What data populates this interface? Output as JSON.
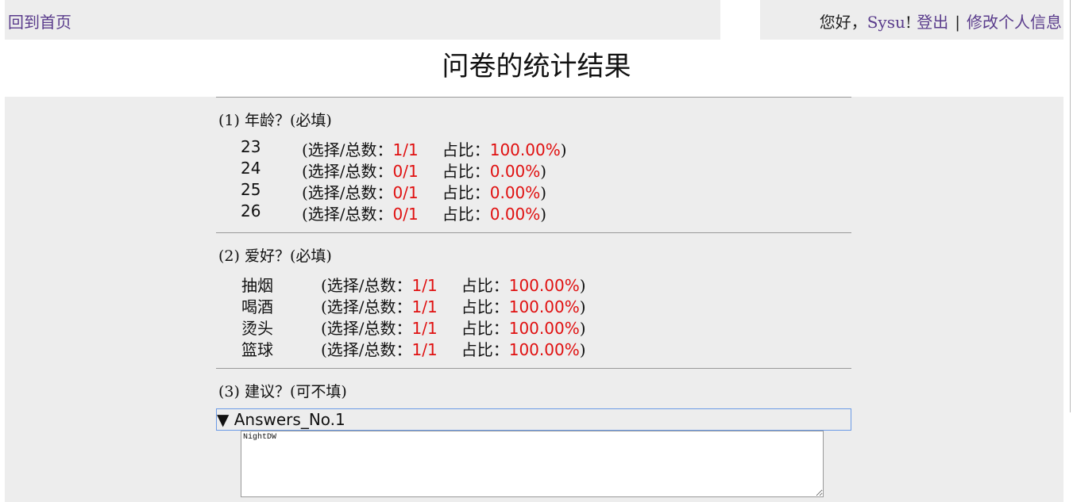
{
  "header": {
    "home_link": "回到首页",
    "greeting_prefix": "您好，",
    "username": "Sysu",
    "greeting_suffix": "!",
    "logout_link": "登出",
    "separator": "|",
    "edit_profile_link": "修改个人信息"
  },
  "page_title": "问卷的统计结果",
  "questions": [
    {
      "title": "(1) 年龄？(必填)",
      "options": [
        {
          "label": "23",
          "stats_prefix": "(选择/总数：",
          "count": "1/1",
          "ratio_prefix": "占比：",
          "ratio": "100.00%",
          "stats_suffix": ")"
        },
        {
          "label": "24",
          "stats_prefix": "(选择/总数：",
          "count": "0/1",
          "ratio_prefix": "占比：",
          "ratio": "0.00%",
          "stats_suffix": ")"
        },
        {
          "label": "25",
          "stats_prefix": "(选择/总数：",
          "count": "0/1",
          "ratio_prefix": "占比：",
          "ratio": "0.00%",
          "stats_suffix": ")"
        },
        {
          "label": "26",
          "stats_prefix": "(选择/总数：",
          "count": "0/1",
          "ratio_prefix": "占比：",
          "ratio": "0.00%",
          "stats_suffix": ")"
        }
      ]
    },
    {
      "title": "(2) 爱好？(必填)",
      "options": [
        {
          "label": "抽烟",
          "stats_prefix": "(选择/总数：",
          "count": "1/1",
          "ratio_prefix": "占比：",
          "ratio": "100.00%",
          "stats_suffix": ")"
        },
        {
          "label": "喝酒",
          "stats_prefix": "(选择/总数：",
          "count": "1/1",
          "ratio_prefix": "占比：",
          "ratio": "100.00%",
          "stats_suffix": ")"
        },
        {
          "label": "烫头",
          "stats_prefix": "(选择/总数：",
          "count": "1/1",
          "ratio_prefix": "占比：",
          "ratio": "100.00%",
          "stats_suffix": ")"
        },
        {
          "label": "篮球",
          "stats_prefix": "(选择/总数：",
          "count": "1/1",
          "ratio_prefix": "占比：",
          "ratio": "100.00%",
          "stats_suffix": ")"
        }
      ]
    },
    {
      "title": "(3) 建议？(可不填)",
      "answers_toggle": "▼ Answers_No.1",
      "answer_text": "NightDW"
    }
  ]
}
